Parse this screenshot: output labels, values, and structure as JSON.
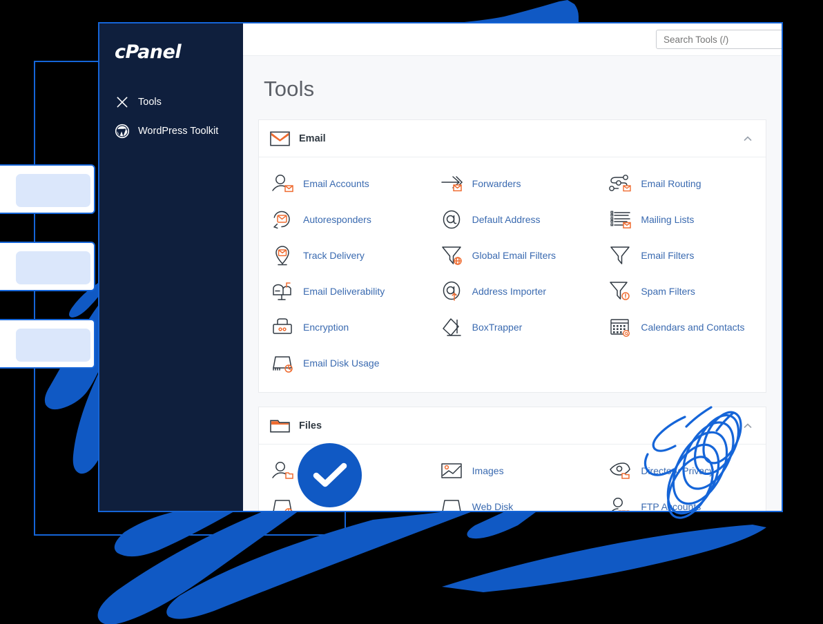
{
  "window": {
    "brand": "cPanel",
    "page_title": "Tools"
  },
  "search": {
    "placeholder": "Search Tools (/)",
    "value": ""
  },
  "sidebar": {
    "items": [
      {
        "label": "Tools",
        "icon": "tools-icon"
      },
      {
        "label": "WordPress Toolkit",
        "icon": "wordpress-icon"
      }
    ]
  },
  "sections": [
    {
      "id": "email",
      "title": "Email",
      "icon": "envelope-icon",
      "collapse_icon": "chevron-up-icon",
      "tools": [
        {
          "label": "Email Accounts",
          "icon": "user-envelope-icon"
        },
        {
          "label": "Forwarders",
          "icon": "arrow-envelope-icon"
        },
        {
          "label": "Email Routing",
          "icon": "routing-envelope-icon"
        },
        {
          "label": "Autoresponders",
          "icon": "circle-arrow-envelope-icon"
        },
        {
          "label": "Default Address",
          "icon": "at-sign-icon"
        },
        {
          "label": "Mailing Lists",
          "icon": "list-envelope-icon"
        },
        {
          "label": "Track Delivery",
          "icon": "pin-envelope-icon"
        },
        {
          "label": "Global Email Filters",
          "icon": "funnel-globe-icon"
        },
        {
          "label": "Email Filters",
          "icon": "funnel-icon"
        },
        {
          "label": "Email Deliverability",
          "icon": "mailbox-icon"
        },
        {
          "label": "Address Importer",
          "icon": "at-sign-arrow-icon"
        },
        {
          "label": "Spam Filters",
          "icon": "funnel-alert-icon"
        },
        {
          "label": "Encryption",
          "icon": "lock-dots-icon"
        },
        {
          "label": "BoxTrapper",
          "icon": "box-trap-icon"
        },
        {
          "label": "Calendars and Contacts",
          "icon": "calendar-at-icon"
        },
        {
          "label": "Email Disk Usage",
          "icon": "disk-pie-icon"
        }
      ]
    },
    {
      "id": "files",
      "title": "Files",
      "icon": "folder-icon",
      "collapse_icon": "chevron-up-icon",
      "tools": [
        {
          "label": "",
          "icon": "user-folder-icon"
        },
        {
          "label": "Images",
          "icon": "image-icon"
        },
        {
          "label": "Directory Privacy",
          "icon": "eye-folder-icon"
        },
        {
          "label": "",
          "icon": "disk-pie-icon"
        },
        {
          "label": "Web Disk",
          "icon": "disk-icon"
        },
        {
          "label": "FTP Accounts",
          "icon": "user-ftp-icon"
        }
      ]
    }
  ],
  "overlays": {
    "check_badge": {
      "icon": "check-circle-icon",
      "color": "#1059c4"
    },
    "scribble": {
      "icon": "scribble-annotation-icon",
      "color": "#1565d8"
    }
  },
  "background": {
    "mini_cards": [
      {
        "dots": "three-dots"
      },
      {
        "dots": "three-dots"
      },
      {
        "dots": "three-dots"
      }
    ],
    "accent_color": "#1565d8",
    "brush_color": "#1059c4",
    "page_background": "#000000"
  }
}
